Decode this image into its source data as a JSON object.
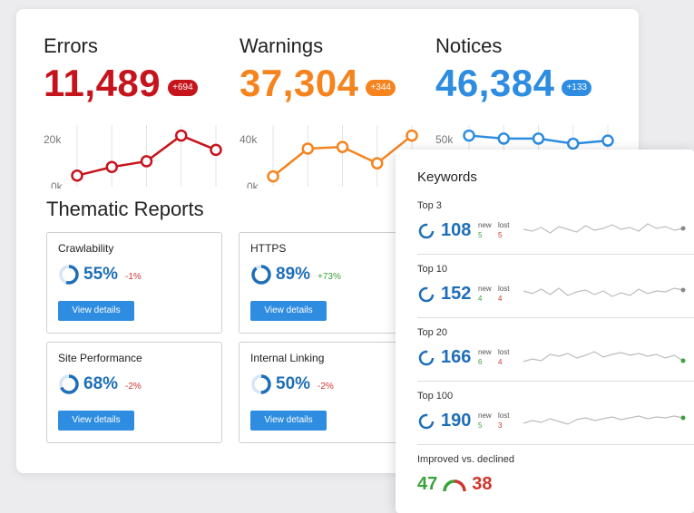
{
  "stats": [
    {
      "label": "Errors",
      "value": "11,489",
      "delta": "+694",
      "color": "#c6141d",
      "ymax": "20k",
      "ymin": "0k",
      "series": [
        2,
        5,
        7,
        16,
        11
      ]
    },
    {
      "label": "Warnings",
      "value": "37,304",
      "delta": "+344",
      "color": "#f5841f",
      "ymax": "40k",
      "ymin": "0k",
      "series": [
        3,
        20,
        21,
        11,
        28
      ]
    },
    {
      "label": "Notices",
      "value": "46,384",
      "delta": "+133",
      "color": "#2e8de0",
      "ymax": "50k",
      "ymin": "",
      "series": [
        45,
        42,
        42,
        37,
        40
      ]
    }
  ],
  "thematic": {
    "title": "Thematic Reports",
    "reports": [
      {
        "name": "Crawlability",
        "percent": "55%",
        "pct_value": 55,
        "change": "-1%",
        "change_color": "#d0342c",
        "button": "View details"
      },
      {
        "name": "HTTPS",
        "percent": "89%",
        "pct_value": 89,
        "change": "+73%",
        "change_color": "#3aa33a",
        "button": "View details"
      },
      {
        "name": "Site Performance",
        "percent": "68%",
        "pct_value": 68,
        "change": "-2%",
        "change_color": "#d0342c",
        "button": "View details"
      },
      {
        "name": "Internal Linking",
        "percent": "50%",
        "pct_value": 50,
        "change": "-2%",
        "change_color": "#d0342c",
        "button": "View details"
      }
    ]
  },
  "keywords": {
    "title": "Keywords",
    "rows": [
      {
        "label": "Top 3",
        "value": "108",
        "new_label": "new",
        "new": "5",
        "lost_label": "lost",
        "lost": "5",
        "dot_color": "#888888"
      },
      {
        "label": "Top 10",
        "value": "152",
        "new_label": "new",
        "new": "4",
        "lost_label": "lost",
        "lost": "4",
        "dot_color": "#888888"
      },
      {
        "label": "Top 20",
        "value": "166",
        "new_label": "new",
        "new": "6",
        "lost_label": "lost",
        "lost": "4",
        "dot_color": "#3aa33a"
      },
      {
        "label": "Top 100",
        "value": "190",
        "new_label": "new",
        "new": "5",
        "lost_label": "lost",
        "lost": "3",
        "dot_color": "#3aa33a"
      }
    ],
    "improved_label": "Improved vs. declined",
    "improved": "47",
    "declined": "38"
  },
  "colors": {
    "blue": "#1f6fb7",
    "green": "#3aa33a",
    "red": "#d0342c"
  }
}
